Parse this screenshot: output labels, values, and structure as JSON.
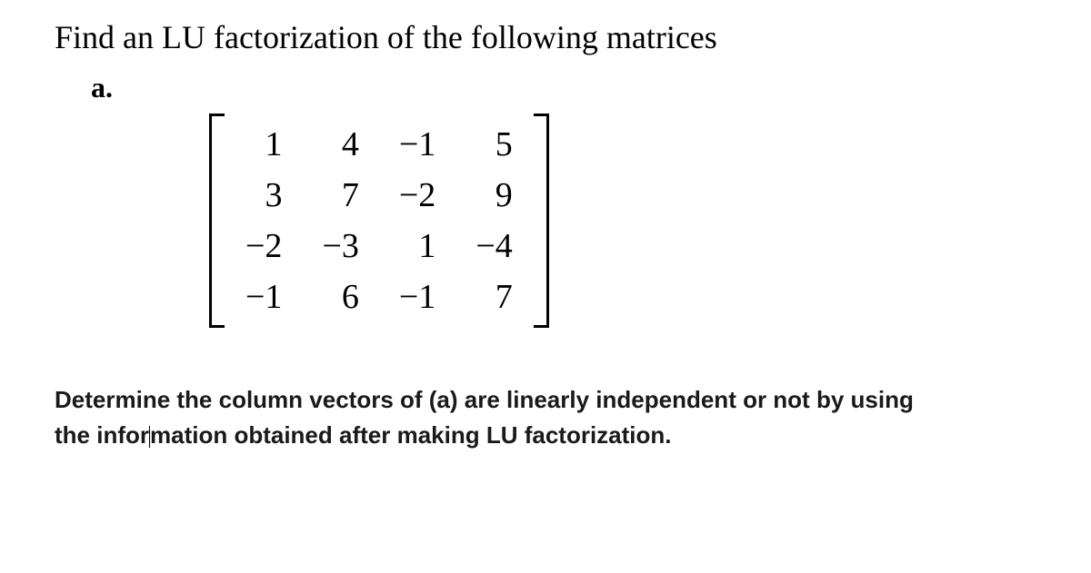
{
  "title": "Find an LU factorization of the following matrices",
  "label": "a.",
  "matrix": {
    "rows": [
      [
        "1",
        "4",
        "−1",
        "5"
      ],
      [
        "3",
        "7",
        "−2",
        "9"
      ],
      [
        "−2",
        "−3",
        "1",
        "−4"
      ],
      [
        "−1",
        "6",
        "−1",
        "7"
      ]
    ]
  },
  "question_part1": "Determine the column vectors of (a) are linearly independent or not by using",
  "question_part2a": "the infor",
  "question_part2b": "mation obtained after making LU factorization."
}
